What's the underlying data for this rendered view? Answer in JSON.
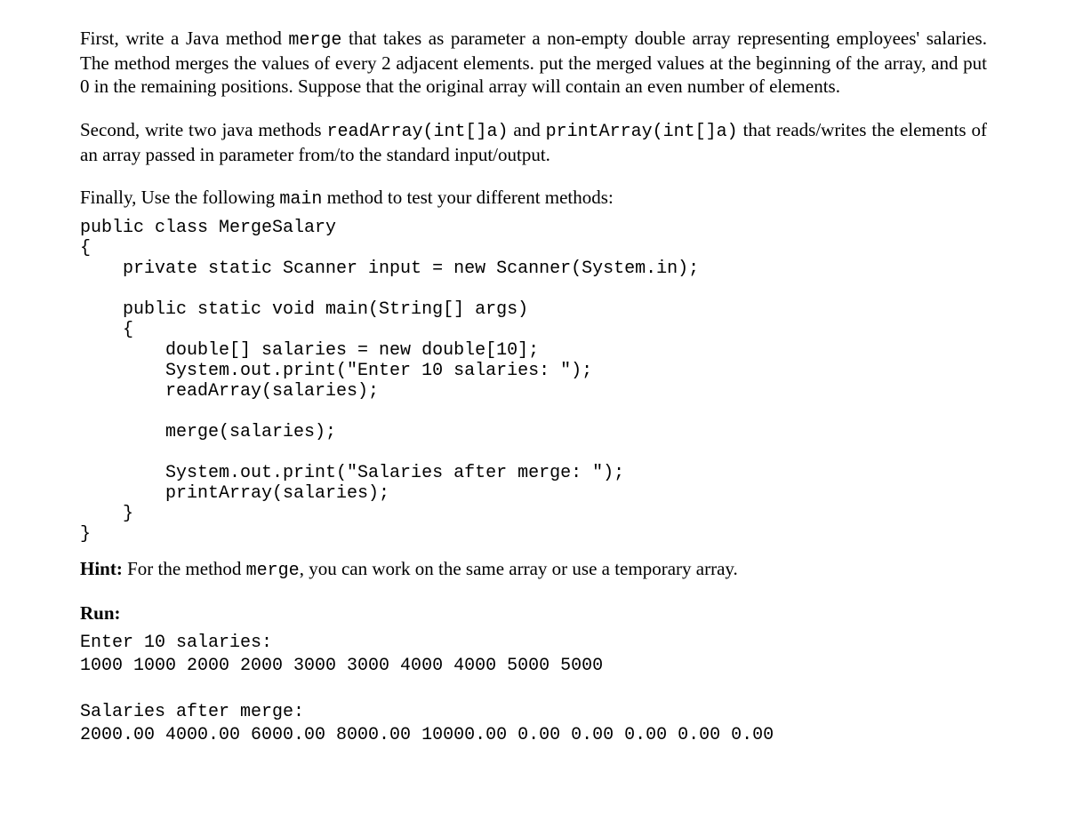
{
  "p1": {
    "t1": "First, write a Java method ",
    "m1": "merge",
    "t2": " that takes as parameter a non-empty double array representing employees' salaries. The method merges the values of every 2 adjacent elements. put the merged values at the beginning of the array, and put 0 in the remaining positions. Suppose that the original array will contain an even number of elements."
  },
  "p2": {
    "t1": "Second, write two java methods ",
    "m1": "readArray(int[]a)",
    "t2": " and ",
    "m2": "printArray(int[]a)",
    "t3": " that reads/writes the elements of an array passed in parameter from/to the standard input/output."
  },
  "p3": {
    "t1": "Finally, Use the following ",
    "m1": "main",
    "t2": " method to test your different methods:"
  },
  "code": "public class MergeSalary\n{\n    private static Scanner input = new Scanner(System.in);\n\n    public static void main(String[] args)\n    {\n        double[] salaries = new double[10];\n        System.out.print(\"Enter 10 salaries: \");\n        readArray(salaries);\n\n        merge(salaries);\n\n        System.out.print(\"Salaries after merge: \");\n        printArray(salaries);\n    }\n}",
  "hint": {
    "label": "Hint:",
    "t1": " For the method ",
    "m1": "merge",
    "t2": ", you can work on the same array or use a temporary array."
  },
  "run": {
    "label": "Run:",
    "line1": "Enter 10 salaries:",
    "line2": "1000 1000 2000 2000 3000 3000 4000 4000 5000 5000",
    "line3": "Salaries after merge:",
    "line4": "2000.00 4000.00 6000.00 8000.00 10000.00 0.00 0.00 0.00 0.00 0.00"
  }
}
